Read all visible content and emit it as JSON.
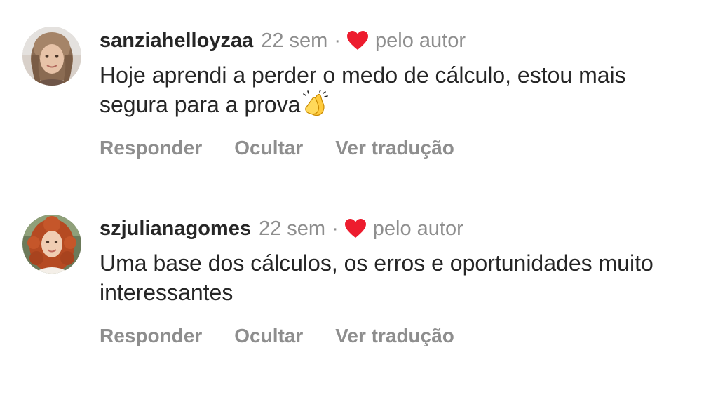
{
  "comments": [
    {
      "username": "sanziahelloyzaa",
      "time": "22 sem",
      "separator": "·",
      "liked_by_author_label": "pelo autor",
      "text": "Hoje aprendi a perder o medo de cálculo, estou mais segura para a prova",
      "emoji": "clapping-hands",
      "actions": {
        "reply": "Responder",
        "hide": "Ocultar",
        "translate": "Ver tradução"
      }
    },
    {
      "username": "szjulianagomes",
      "time": "22 sem",
      "separator": "·",
      "liked_by_author_label": "pelo autor",
      "text": "Uma base dos cálculos, os erros e oportunidades muito interessantes",
      "actions": {
        "reply": "Responder",
        "hide": "Ocultar",
        "translate": "Ver tradução"
      }
    }
  ],
  "icons": {
    "heart": "heart-icon",
    "clap": "clapping-hands-icon"
  },
  "colors": {
    "text_primary": "#262626",
    "text_secondary": "#8e8e8e",
    "heart": "#ed1c2e",
    "background": "#ffffff"
  }
}
